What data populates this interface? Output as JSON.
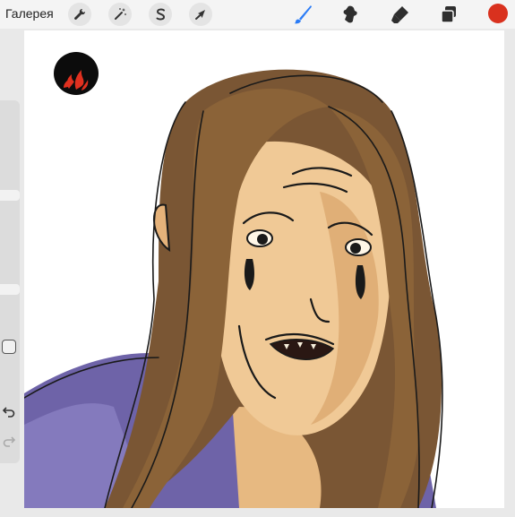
{
  "toolbar": {
    "gallery_label": "Галерея",
    "left_tools": [
      "wrench-icon",
      "magic-wand-icon",
      "selection-icon",
      "transform-arrow-icon"
    ],
    "right_tools": [
      "brush-icon",
      "smudge-icon",
      "eraser-icon",
      "layers-icon"
    ],
    "active_tool": "brush-icon",
    "active_color": "#d9311e",
    "accent": "#2b7cf6"
  },
  "sidebar": {
    "brush_size": 0.25,
    "brush_opacity": 0.5,
    "undo_icon": "undo-arrow-icon",
    "redo_icon": "redo-arrow-icon"
  },
  "canvas": {
    "artwork": "painted-portrait-image",
    "logo_icon": "flame-logo-icon"
  }
}
